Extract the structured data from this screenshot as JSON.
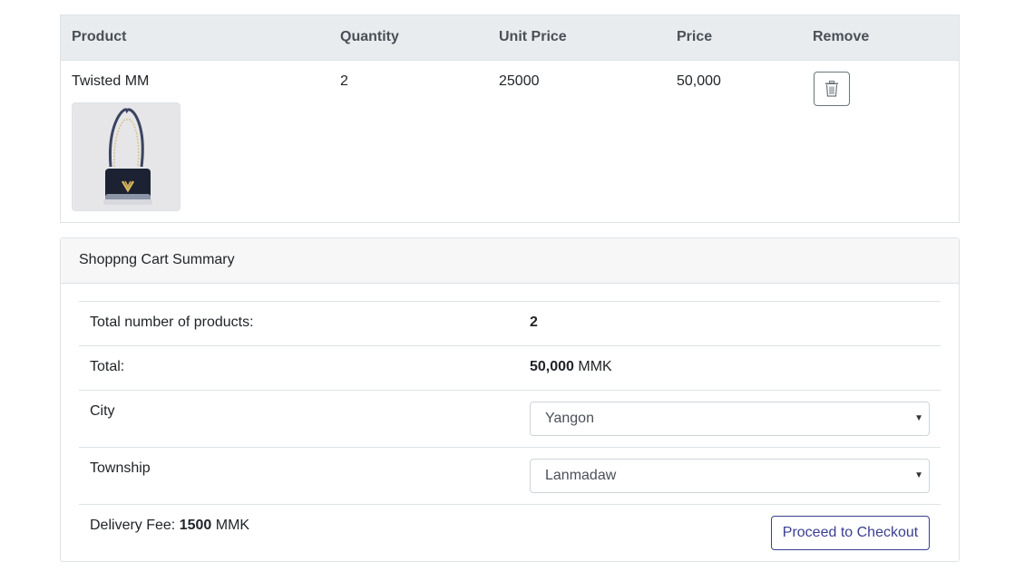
{
  "cart": {
    "headers": [
      "Product",
      "Quantity",
      "Unit Price",
      "Price",
      "Remove"
    ],
    "rows": [
      {
        "product": "Twisted MM",
        "quantity": "2",
        "unit_price": "25000",
        "price": "50,000",
        "image_icon": "handbag-image"
      }
    ]
  },
  "summary": {
    "title": "Shoppng Cart Summary",
    "total_products_label": "Total number of products:",
    "total_products_value": "2",
    "total_label": "Total:",
    "total_value": "50,000",
    "total_currency": "MMK",
    "city_label": "City",
    "city_selected": "Yangon",
    "township_label": "Township",
    "township_selected": "Lanmadaw",
    "delivery_label": "Delivery Fee:",
    "delivery_value": "1500",
    "delivery_currency": "MMK",
    "checkout_label": "Proceed to Checkout"
  },
  "colors": {
    "header_bg": "#e9ecef",
    "checkout_accent": "#3a3f8f"
  }
}
